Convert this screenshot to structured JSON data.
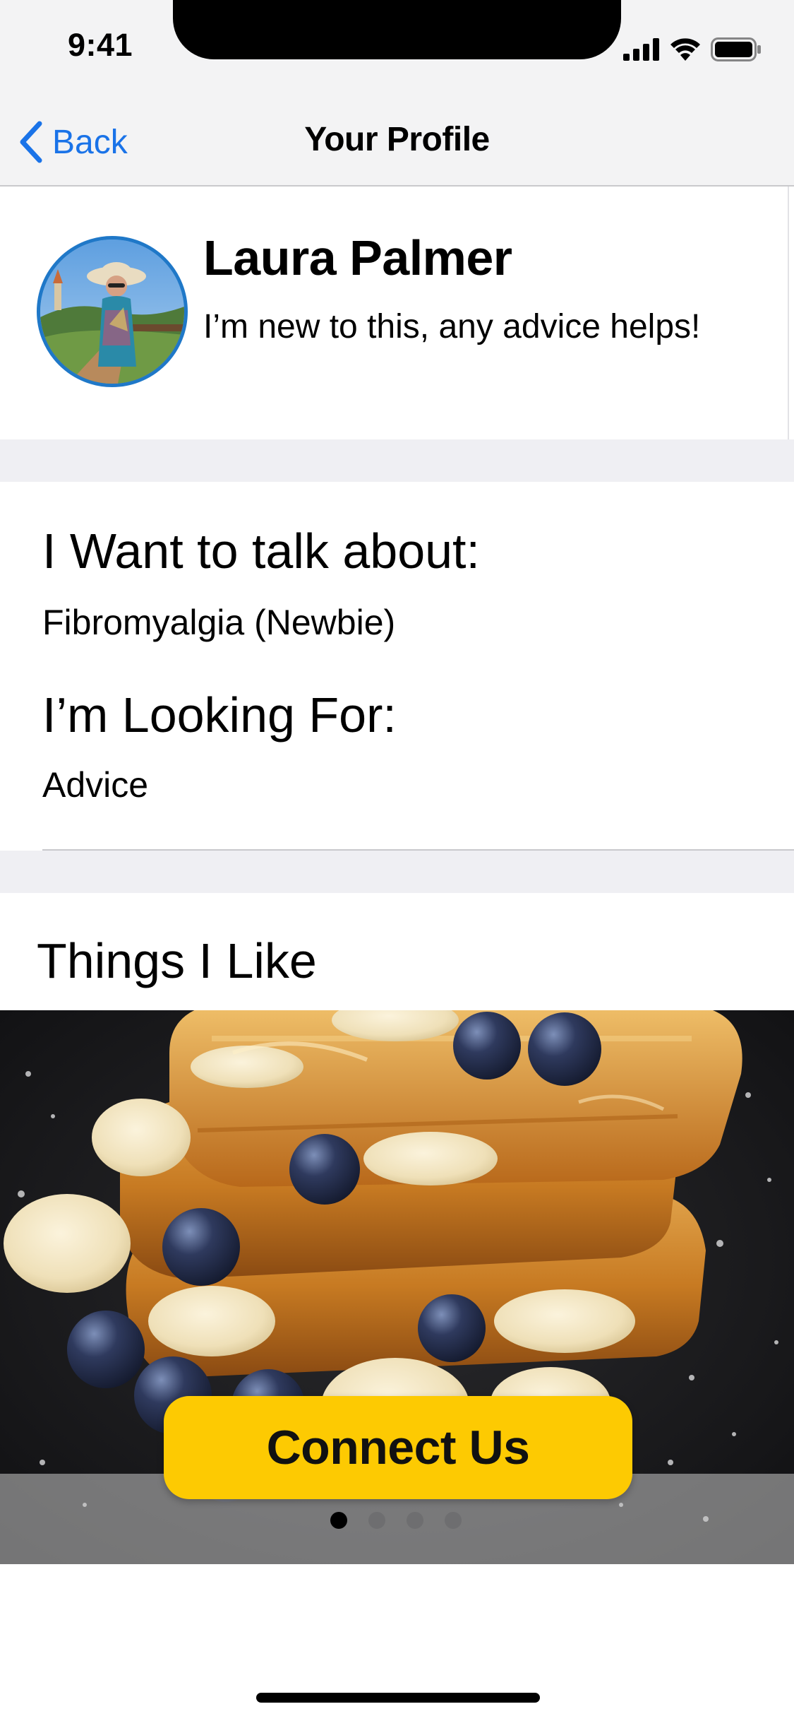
{
  "status_bar": {
    "time": "9:41",
    "icons": [
      "signal-icon",
      "wifi-icon",
      "battery-icon"
    ]
  },
  "nav": {
    "back_label": "Back",
    "title": "Your Profile"
  },
  "profile": {
    "name": "Laura Palmer",
    "bio": "I’m new to this, any advice helps!",
    "avatar": "profile-photo"
  },
  "preferences": {
    "talk_heading": "I Want to talk about:",
    "talk_value": "Fibromyalgia (Newbie)",
    "looking_heading": "I’m Looking For:",
    "looking_value": "Advice"
  },
  "likes": {
    "title": "Things I Like",
    "photo": "french-toast-photo",
    "page_count": 4,
    "current_page": 1
  },
  "cta": {
    "label": "Connect Us"
  },
  "colors": {
    "accent_blue": "#1a73e8",
    "avatar_ring": "#1f78c8",
    "cta_yellow": "#fdca02",
    "separator_gray": "#efeff3"
  }
}
